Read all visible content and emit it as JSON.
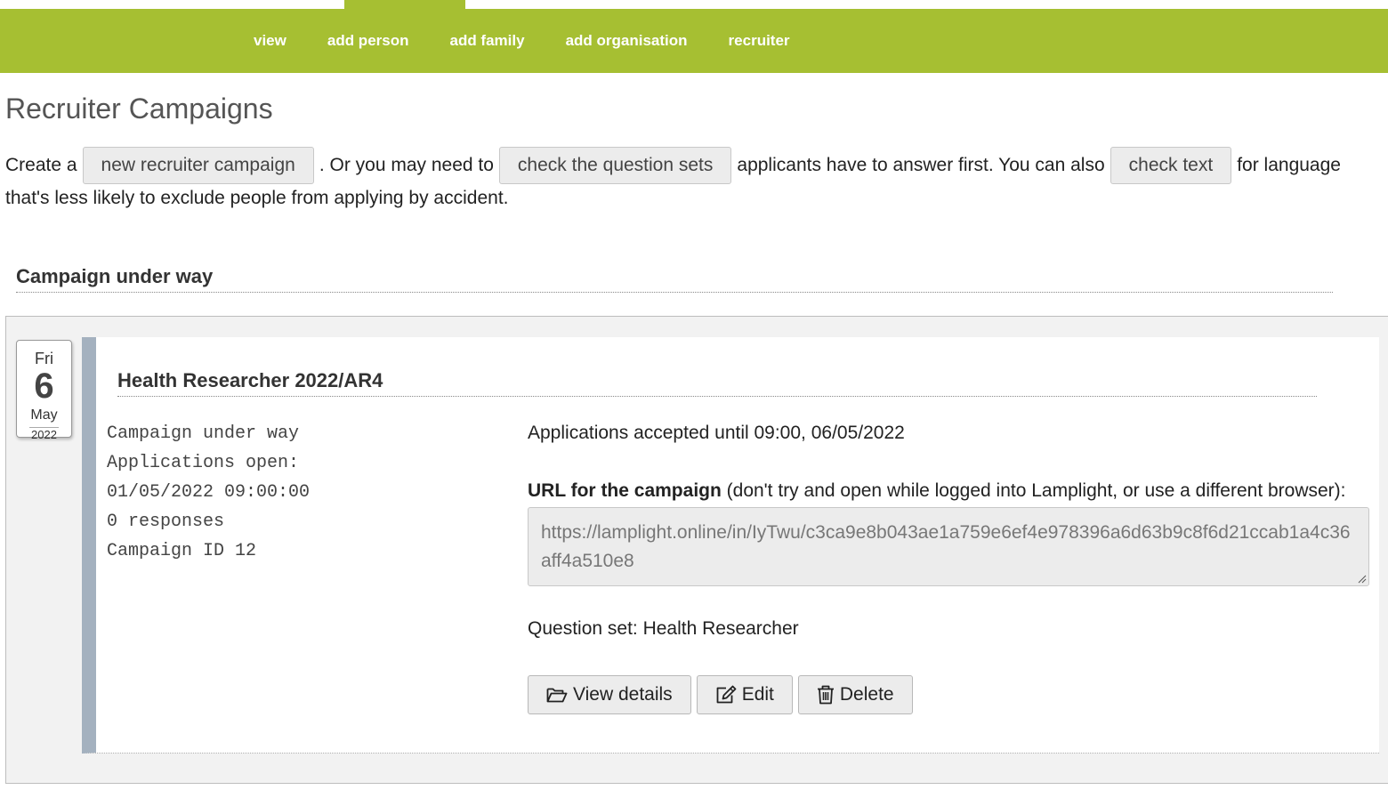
{
  "nav": {
    "items": [
      {
        "label": "view"
      },
      {
        "label": "add person"
      },
      {
        "label": "add family"
      },
      {
        "label": "add organisation"
      },
      {
        "label": "recruiter"
      }
    ],
    "bar_color": "#a6bf32"
  },
  "page": {
    "title": "Recruiter Campaigns",
    "intro": {
      "text1": "Create a",
      "btn_new_campaign": "new recruiter campaign",
      "text2": ". Or you may need to",
      "btn_check_questions": "check the question sets",
      "text3": "applicants have to answer first. You can also",
      "btn_check_text": "check text",
      "text4": "for language",
      "text5": "that's less likely to exclude people from applying by accident."
    }
  },
  "section": {
    "heading": "Campaign under way"
  },
  "campaign": {
    "date": {
      "dow": "Fri",
      "day": "6",
      "month": "May",
      "year": "2022"
    },
    "title": "Health Researcher 2022/AR4",
    "status": "Campaign under way",
    "open_label": "Applications open:",
    "open_datetime": "01/05/2022 09:00:00",
    "responses": "0 responses",
    "campaign_id": "Campaign ID 12",
    "accepted_until": "Applications accepted until 09:00, 06/05/2022",
    "url_label_bold": "URL for the campaign",
    "url_label_rest": " (don't try and open while logged into Lamplight, or use a different browser):",
    "url": "https://lamplight.online/in/IyTwu/c3ca9e8b043ae1a759e6ef4e978396a6d63b9c8f6d21ccab1a4c36aff4a510e8",
    "question_set": "Question set: Health Researcher",
    "actions": {
      "view_details": "View details",
      "edit": "Edit",
      "delete": "Delete"
    },
    "accent_color": "#a4b1bf"
  }
}
